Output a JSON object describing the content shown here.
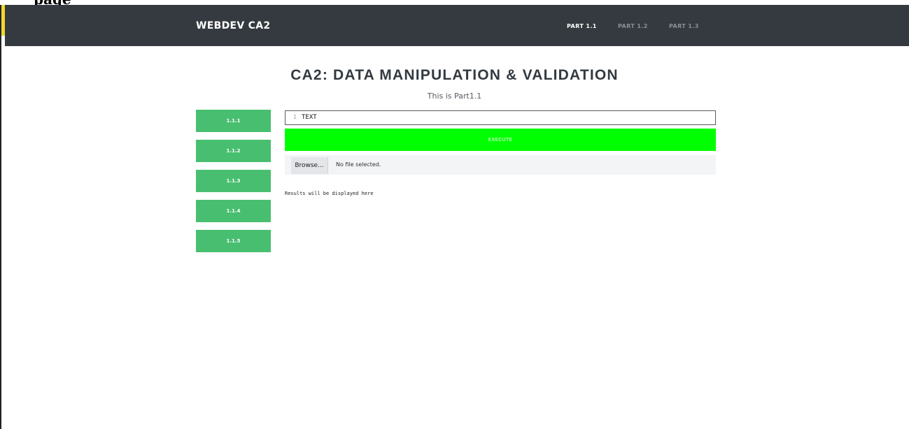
{
  "cropped_heading": "page",
  "navbar": {
    "brand": "WEBDEV CA2",
    "links": [
      {
        "label": "PART 1.1",
        "active": true
      },
      {
        "label": "PART 1.2",
        "active": false
      },
      {
        "label": "PART 1.3",
        "active": false
      }
    ],
    "bg_color": "#343a40"
  },
  "main": {
    "title": "CA2: DATA MANIPULATION & VALIDATION",
    "subtitle": "This is Part1.1"
  },
  "sidebar": {
    "items": [
      {
        "label": "1.1.1"
      },
      {
        "label": "1.1.2"
      },
      {
        "label": "1.1.3"
      },
      {
        "label": "1.1.4"
      },
      {
        "label": "1.1.5"
      }
    ],
    "color": "#48bf70"
  },
  "editor": {
    "line_number": "1",
    "text": "TEXT"
  },
  "execute_button": {
    "label": "EXECUTE",
    "color": "#00ff00"
  },
  "file_input": {
    "button_label": "Browse...",
    "status": "No file selected."
  },
  "results": {
    "text": "Results will be displayed here"
  }
}
